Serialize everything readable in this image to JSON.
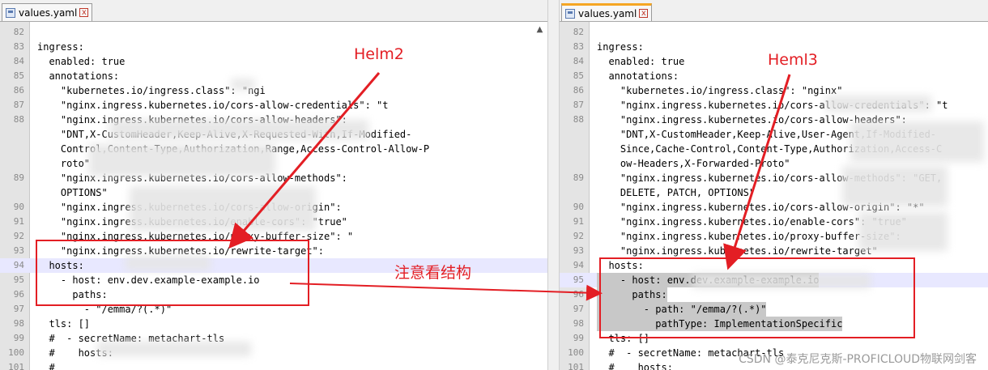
{
  "left": {
    "tab_label": "values.yaml",
    "close_symbol": "x",
    "lines": [
      {
        "n": "82",
        "code": ""
      },
      {
        "n": "83",
        "code": "ingress:"
      },
      {
        "n": "84",
        "code": "  enabled: true"
      },
      {
        "n": "85",
        "code": "  annotations:"
      },
      {
        "n": "86",
        "code": "    \"kubernetes.io/ingress.class\": \"ngi"
      },
      {
        "n": "87",
        "code": "    \"nginx.ingress.kubernetes.io/cors-allow-credentials\": \"t"
      },
      {
        "n": "88",
        "code": "    \"nginx.ingress.kubernetes.io/cors-allow-headers\":"
      },
      {
        "n": "",
        "code": "    \"DNT,X-CustomHeader,Keep-Alive,X-Requested-With,If-Modified-"
      },
      {
        "n": "",
        "code": "    Control,Content-Type,Authorization,Range,Access-Control-Allow-P"
      },
      {
        "n": "",
        "code": "    roto\""
      },
      {
        "n": "89",
        "code": "    \"nginx.ingress.kubernetes.io/cors-allow-methods\":"
      },
      {
        "n": "",
        "code": "    OPTIONS\""
      },
      {
        "n": "90",
        "code": "    \"nginx.ingress.kubernetes.io/cors-allow-origin\":"
      },
      {
        "n": "91",
        "code": "    \"nginx.ingress.kubernetes.io/enable-cors\": \"true\""
      },
      {
        "n": "92",
        "code": "    \"nginx.ingress.kubernetes.io/proxy-buffer-size\": \""
      },
      {
        "n": "93",
        "code": "    \"nginx.ingress.kubernetes.io/rewrite-target\":"
      },
      {
        "n": "94",
        "code": "  hosts:"
      },
      {
        "n": "95",
        "code": "    - host: env.dev.example-example.io"
      },
      {
        "n": "96",
        "code": "      paths:"
      },
      {
        "n": "97",
        "code": "        - \"/emma/?(.*)\""
      },
      {
        "n": "98",
        "code": "  tls: []"
      },
      {
        "n": "99",
        "code": "  #  - secretName: metachart-tls"
      },
      {
        "n": "100",
        "code": "  #    hosts:"
      },
      {
        "n": "101",
        "code": "  #"
      }
    ]
  },
  "right": {
    "tab_label": "values.yaml",
    "close_symbol": "x",
    "lines": [
      {
        "n": "82",
        "code": ""
      },
      {
        "n": "83",
        "code": "ingress:"
      },
      {
        "n": "84",
        "code": "  enabled: true"
      },
      {
        "n": "85",
        "code": "  annotations:"
      },
      {
        "n": "86",
        "code": "    \"kubernetes.io/ingress.class\": \"nginx\""
      },
      {
        "n": "87",
        "code": "    \"nginx.ingress.kubernetes.io/cors-allow-credentials\": \"t"
      },
      {
        "n": "88",
        "code": "    \"nginx.ingress.kubernetes.io/cors-allow-headers\":"
      },
      {
        "n": "",
        "code": "    \"DNT,X-CustomHeader,Keep-Alive,User-Agent,If-Modified-"
      },
      {
        "n": "",
        "code": "    Since,Cache-Control,Content-Type,Authorization,Access-C"
      },
      {
        "n": "",
        "code": "    ow-Headers,X-Forwarded-Proto\""
      },
      {
        "n": "89",
        "code": "    \"nginx.ingress.kubernetes.io/cors-allow-methods\": \"GET,"
      },
      {
        "n": "",
        "code": "    DELETE, PATCH, OPTIONS\""
      },
      {
        "n": "90",
        "code": "    \"nginx.ingress.kubernetes.io/cors-allow-origin\": \"*\""
      },
      {
        "n": "91",
        "code": "    \"nginx.ingress.kubernetes.io/enable-cors\": \"true\""
      },
      {
        "n": "92",
        "code": "    \"nginx.ingress.kubernetes.io/proxy-buffer-size\":"
      },
      {
        "n": "93",
        "code": "    \"nginx.ingress.kubernetes.io/rewrite-target\""
      },
      {
        "n": "94",
        "code": "  hosts:"
      },
      {
        "n": "95",
        "code": "    - host: env.dev.example-example.io"
      },
      {
        "n": "96",
        "code": "      paths:"
      },
      {
        "n": "97",
        "code": "        - path: \"/emma/?(.*)\""
      },
      {
        "n": "98",
        "code": "          pathType: ImplementationSpecific"
      },
      {
        "n": "99",
        "code": "  tls: []"
      },
      {
        "n": "100",
        "code": "  #  - secretName: metachart-tls"
      },
      {
        "n": "101",
        "code": "  #    hosts:"
      }
    ]
  },
  "annotations": {
    "left_label": "Helm2",
    "right_label": "Heml3",
    "middle_label": "注意看结构",
    "watermark": "CSDN @泰克尼克斯-PROFICLOUD物联网剑客"
  },
  "colors": {
    "annotation_red": "#e31e24",
    "highlight_line": "#e8e8ff",
    "gutter_bg": "#e4e4e4"
  }
}
